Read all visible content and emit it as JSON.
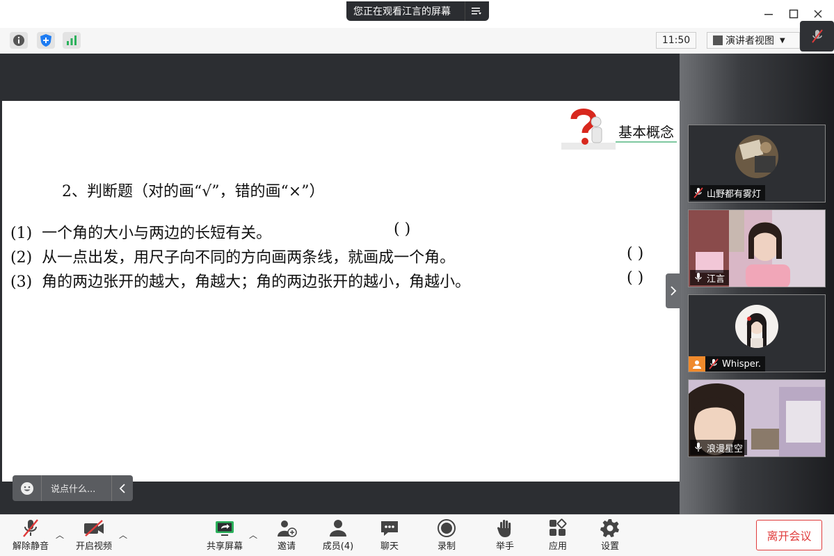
{
  "window": {
    "share_banner": "您正在观看江言的屏幕",
    "minimize_icon": "minimize-icon",
    "maximize_icon": "maximize-icon",
    "close_icon": "close-icon"
  },
  "toolbar": {
    "clock": "11:50",
    "view_mode": "演讲者视图"
  },
  "slide": {
    "section_label": "基本概念",
    "question_title": "2、判断题（对的画“√”，错的画“×”）",
    "items": [
      {
        "num": "(1)",
        "text": "一个角的大小与两边的长短有关。",
        "bracket": "(    )"
      },
      {
        "num": "(2)",
        "text": "从一点出发，用尺子向不同的方向画两条线，就画成一个角。",
        "bracket": "(    )"
      },
      {
        "num": "(3)",
        "text": "角的两边张开的越大，角越大；角的两边张开的越小，角越小。",
        "bracket": "(    )"
      }
    ]
  },
  "chat": {
    "placeholder": "说点什么..."
  },
  "participants": [
    {
      "name": "山野都有雾灯",
      "mic": "muted"
    },
    {
      "name": "江言",
      "mic": "on"
    },
    {
      "name": "Whisper.",
      "mic": "muted"
    },
    {
      "name": "浪漫星空",
      "mic": "on"
    }
  ],
  "bottom": {
    "unmute": "解除静音",
    "start_video": "开启视频",
    "share_screen": "共享屏幕",
    "invite": "邀请",
    "members": "成员(4)",
    "chat": "聊天",
    "record": "录制",
    "raise_hand": "举手",
    "apps": "应用",
    "settings": "设置",
    "leave": "离开会议"
  },
  "colors": {
    "accent_green": "#2bb15b",
    "danger_red": "#e03b3b",
    "shield_blue": "#1e7cf2"
  }
}
